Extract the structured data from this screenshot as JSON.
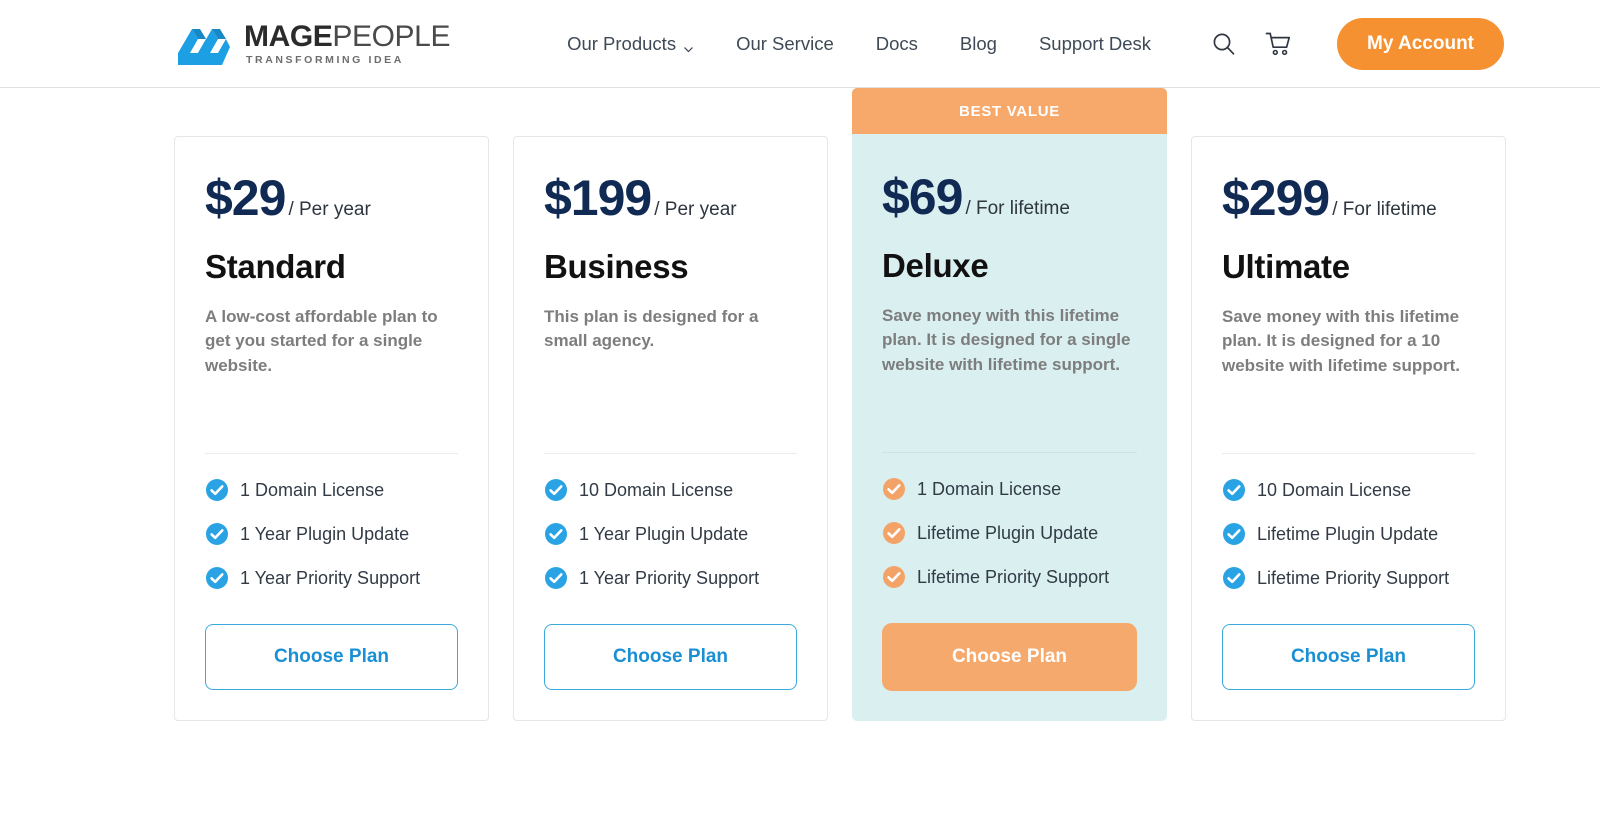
{
  "header": {
    "logo": {
      "mark": "mage-people-logo-mark",
      "title_bold": "MAGE",
      "title_light": "PEOPLE",
      "tagline": "TRANSFORMING IDEA"
    },
    "nav": [
      {
        "label": "Our Products",
        "has_dropdown": true
      },
      {
        "label": "Our Service",
        "has_dropdown": false
      },
      {
        "label": "Docs",
        "has_dropdown": false
      },
      {
        "label": "Blog",
        "has_dropdown": false
      },
      {
        "label": "Support Desk",
        "has_dropdown": false
      }
    ],
    "search_icon": "search-icon",
    "cart_icon": "cart-icon",
    "account_label": "My Account",
    "accent_orange": "#f59130"
  },
  "pricing": {
    "badge_label": "BEST VALUE",
    "colors": {
      "price_navy": "#102a54",
      "check_blue": "#29a3e3",
      "check_orange": "#f4a368",
      "featured_bg": "#d9eff0",
      "badge_bg": "#f7a96b",
      "button_blue": "#1b8fd4"
    },
    "plans": [
      {
        "price": "$29",
        "period": "/ Per year",
        "name": "Standard",
        "description": "A low-cost affordable plan to get you started for a single website.",
        "features": [
          "1 Domain License",
          "1 Year Plugin Update",
          "1 Year Priority Support"
        ],
        "cta": "Choose Plan",
        "featured": false
      },
      {
        "price": "$199",
        "period": "/ Per year",
        "name": "Business",
        "description": "This plan is designed for a small agency.",
        "features": [
          "10 Domain License",
          "1 Year Plugin Update",
          "1 Year Priority Support"
        ],
        "cta": "Choose Plan",
        "featured": false
      },
      {
        "price": "$69",
        "period": "/ For lifetime",
        "name": "Deluxe",
        "description": "Save money with this lifetime plan. It is designed for a single website with lifetime support.",
        "features": [
          "1 Domain License",
          "Lifetime Plugin Update",
          "Lifetime Priority Support"
        ],
        "cta": "Choose Plan",
        "featured": true
      },
      {
        "price": "$299",
        "period": "/ For lifetime",
        "name": "Ultimate",
        "description": "Save money with this lifetime plan. It is designed for a 10 website with lifetime support.",
        "features": [
          "10 Domain License",
          "Lifetime Plugin Update",
          "Lifetime Priority Support"
        ],
        "cta": "Choose Plan",
        "featured": false
      }
    ]
  }
}
